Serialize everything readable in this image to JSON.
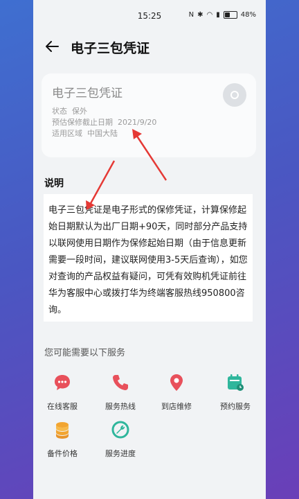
{
  "status_bar": {
    "time": "15:25",
    "battery": "48%"
  },
  "header": {
    "title": "电子三包凭证"
  },
  "card": {
    "title": "电子三包凭证",
    "rows": [
      {
        "label": "状态",
        "value": "保外"
      },
      {
        "label": "预估保修截止日期",
        "value": "2021/9/20"
      },
      {
        "label": "适用区域",
        "value": "中国大陆"
      }
    ]
  },
  "description": {
    "title": "说明",
    "text": "电子三包凭证是电子形式的保修凭证，计算保修起始日期默认为出厂日期+90天，同时部分产品支持以联网使用日期作为保修起始日期（由于信息更新需要一段时间，建议联网使用3-5天后查询），如您对查询的产品权益有疑问，可凭有效购机凭证前往华为客服中心或拨打华为终端客服热线950800咨询。"
  },
  "services": {
    "title": "您可能需要以下服务",
    "items": [
      {
        "label": "在线客服",
        "icon": "chat-bubble-icon",
        "color": "#e8505b"
      },
      {
        "label": "服务热线",
        "icon": "phone-icon",
        "color": "#e8505b"
      },
      {
        "label": "到店维修",
        "icon": "location-pin-icon",
        "color": "#e8505b"
      },
      {
        "label": "预约服务",
        "icon": "calendar-clock-icon",
        "color": "#2fb69c"
      },
      {
        "label": "备件价格",
        "icon": "coin-stack-icon",
        "color": "#f2a531"
      },
      {
        "label": "服务进度",
        "icon": "wrench-progress-icon",
        "color": "#2fb69c"
      }
    ]
  }
}
